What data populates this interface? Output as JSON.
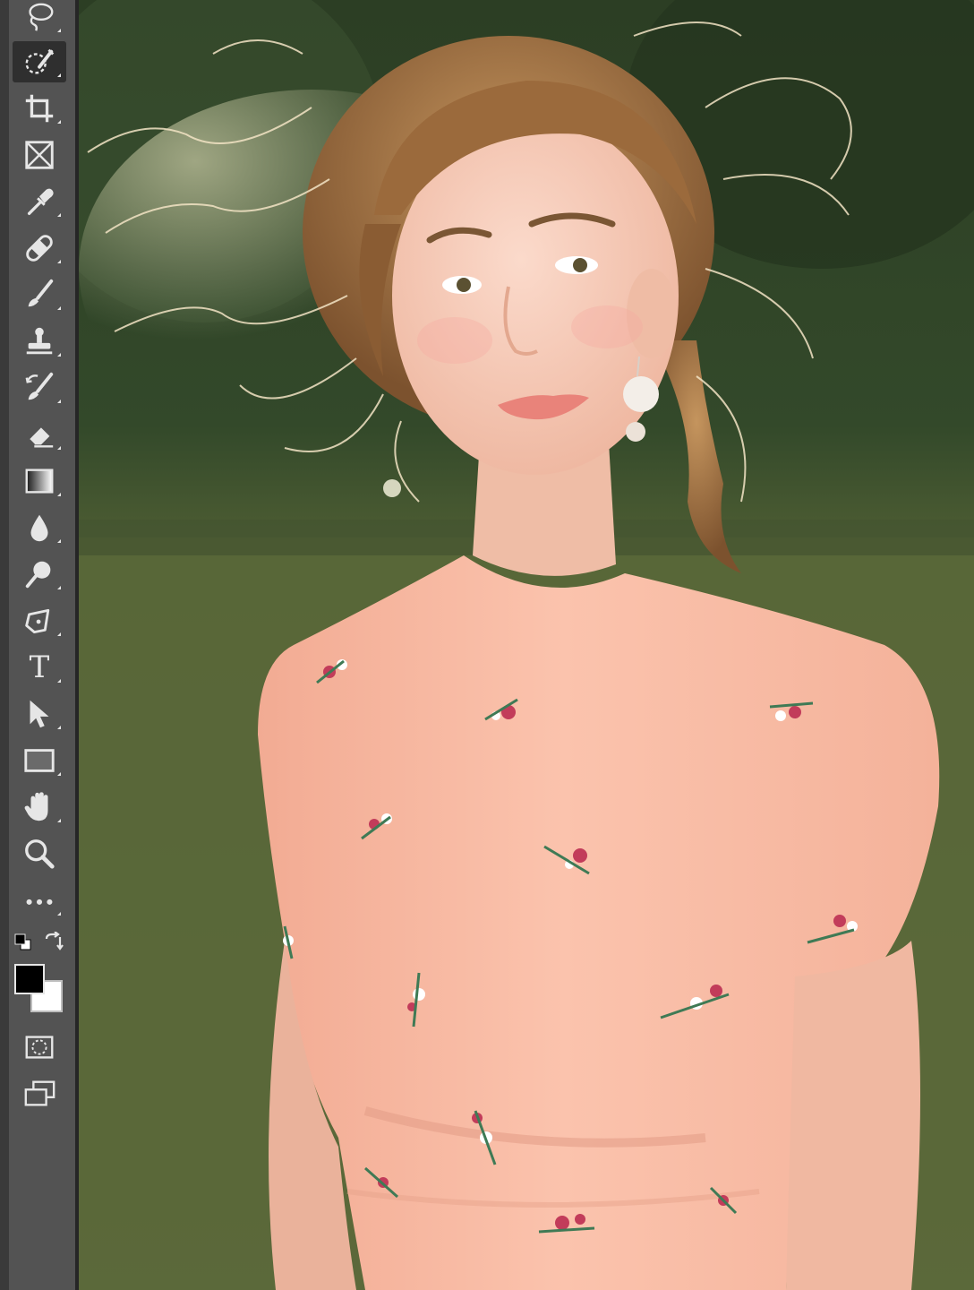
{
  "toolbar": {
    "tools": [
      {
        "name": "lasso-tool",
        "icon": "lasso-icon",
        "flyout": true,
        "active": false
      },
      {
        "name": "quick-selection-tool",
        "icon": "quick-selection-icon",
        "flyout": true,
        "active": true
      },
      {
        "name": "crop-tool",
        "icon": "crop-icon",
        "flyout": true,
        "active": false
      },
      {
        "name": "frame-tool",
        "icon": "frame-icon",
        "flyout": false,
        "active": false
      },
      {
        "name": "eyedropper-tool",
        "icon": "eyedropper-icon",
        "flyout": true,
        "active": false
      },
      {
        "name": "spot-healing-brush-tool",
        "icon": "bandage-icon",
        "flyout": true,
        "active": false
      },
      {
        "name": "brush-tool",
        "icon": "brush-icon",
        "flyout": true,
        "active": false
      },
      {
        "name": "clone-stamp-tool",
        "icon": "stamp-icon",
        "flyout": true,
        "active": false
      },
      {
        "name": "history-brush-tool",
        "icon": "history-brush-icon",
        "flyout": true,
        "active": false
      },
      {
        "name": "eraser-tool",
        "icon": "eraser-icon",
        "flyout": true,
        "active": false
      },
      {
        "name": "gradient-tool",
        "icon": "gradient-icon",
        "flyout": true,
        "active": false
      },
      {
        "name": "blur-tool",
        "icon": "drop-icon",
        "flyout": true,
        "active": false
      },
      {
        "name": "dodge-tool",
        "icon": "dodge-icon",
        "flyout": true,
        "active": false
      },
      {
        "name": "pen-tool",
        "icon": "pen-icon",
        "flyout": true,
        "active": false
      },
      {
        "name": "type-tool",
        "icon": "type-icon",
        "flyout": true,
        "active": false
      },
      {
        "name": "path-selection-tool",
        "icon": "arrow-icon",
        "flyout": true,
        "active": false
      },
      {
        "name": "rectangle-tool",
        "icon": "rectangle-icon",
        "flyout": true,
        "active": false
      },
      {
        "name": "hand-tool",
        "icon": "hand-icon",
        "flyout": true,
        "active": false
      },
      {
        "name": "zoom-tool",
        "icon": "zoom-icon",
        "flyout": false,
        "active": false
      },
      {
        "name": "edit-toolbar",
        "icon": "more-icon",
        "flyout": true,
        "active": false
      }
    ],
    "type_glyph": "T",
    "colors": {
      "foreground": "#000000",
      "background": "#ffffff"
    },
    "bottom_tools": [
      {
        "name": "quick-mask-mode",
        "icon": "quick-mask-icon"
      },
      {
        "name": "screen-mode",
        "icon": "screen-mode-icon"
      }
    ]
  },
  "canvas": {
    "content": "photo",
    "colors": {
      "dress": "#f7b9a1",
      "skin": "#f4c7b3",
      "hair": "#9b6a3c",
      "grass": "#5d6a3c",
      "trees": "#2c3e24"
    }
  }
}
